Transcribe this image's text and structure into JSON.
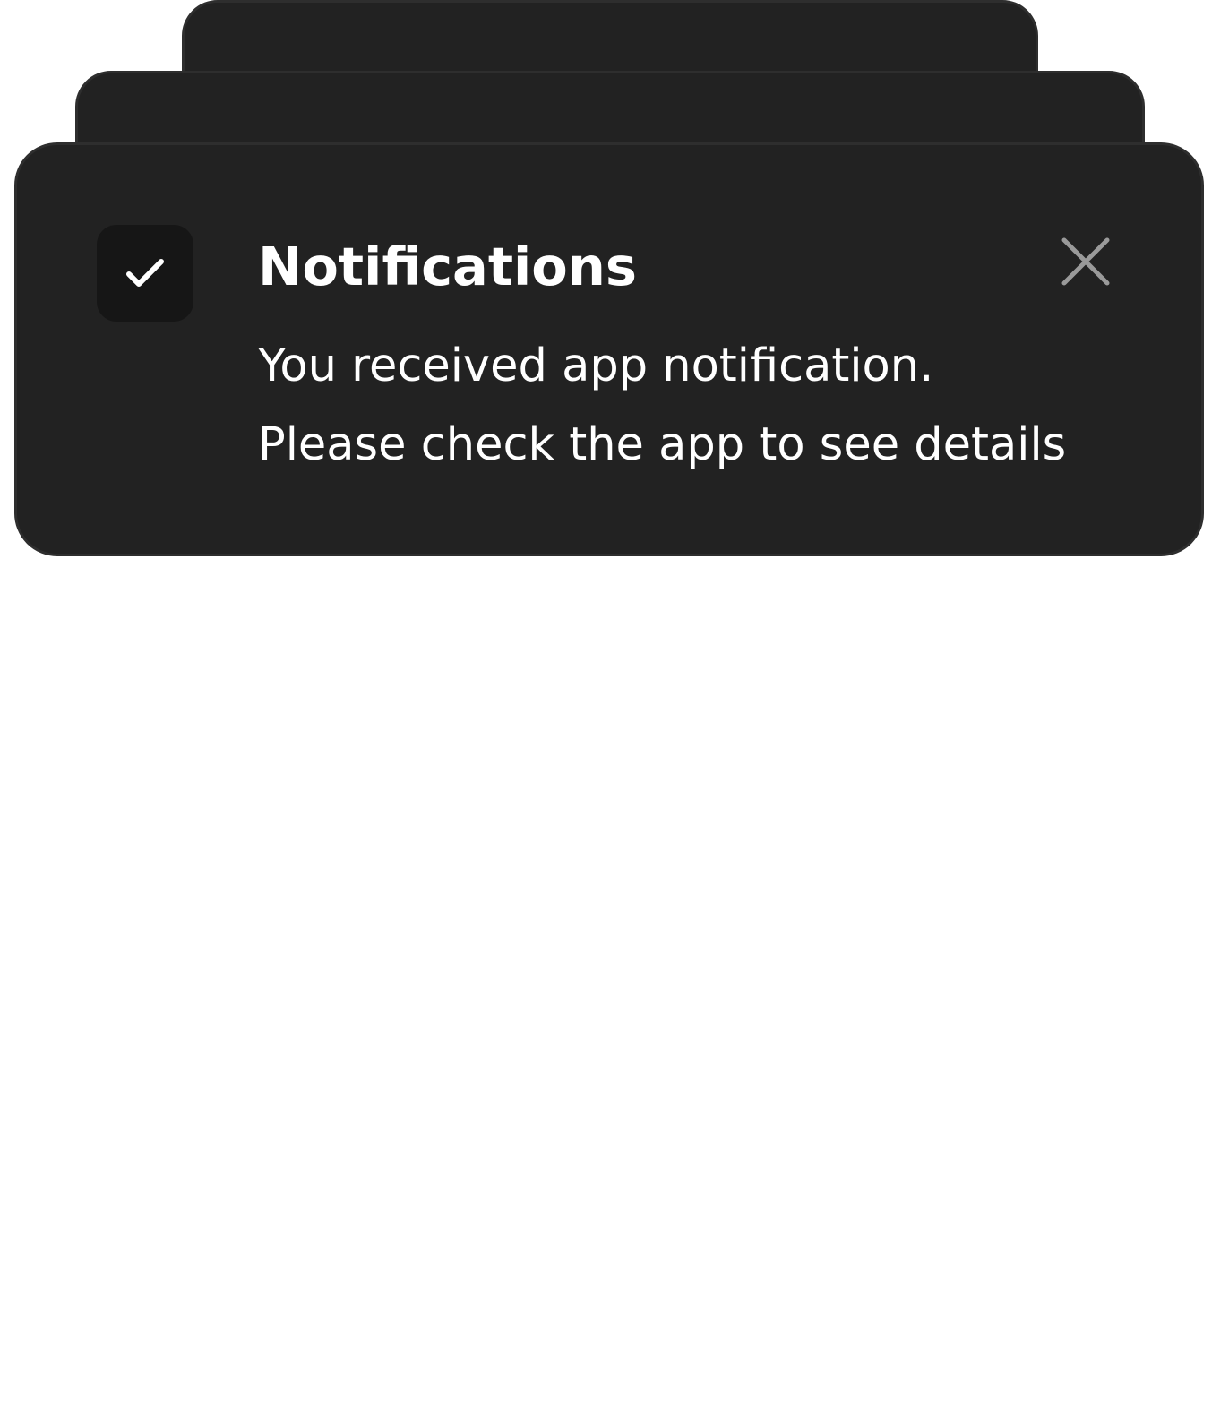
{
  "notification": {
    "title": "Notifications",
    "message_line_1": "You received app notification.",
    "message_line_2": "Please check the app to see details",
    "status_icon": "check-icon",
    "close_icon": "close-icon"
  },
  "colors": {
    "card_background": "#222222",
    "card_border": "#2e2e2e",
    "icon_tile_background": "#161616",
    "title_text": "#ffffff",
    "message_text": "#ffffff",
    "close_icon": "#9a9a9a",
    "page_background": "#ffffff"
  }
}
